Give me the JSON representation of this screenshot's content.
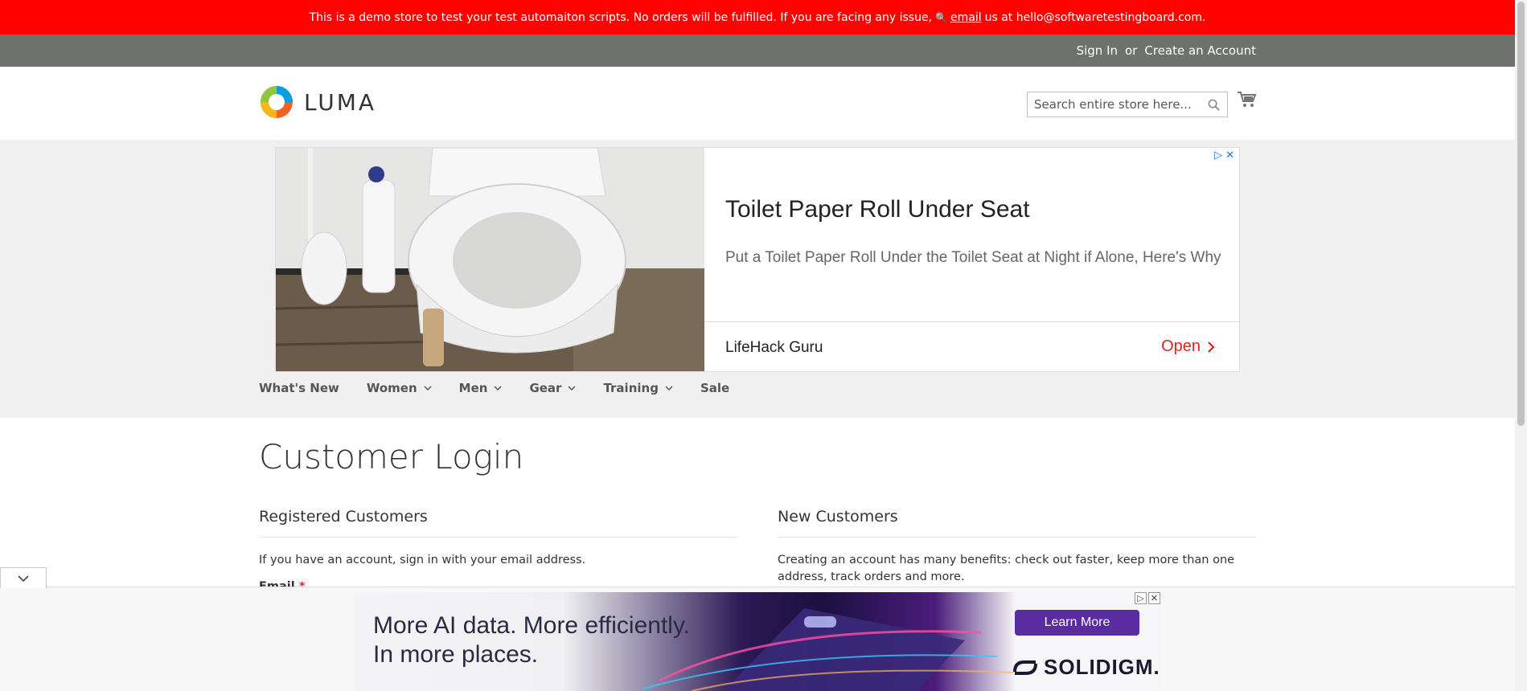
{
  "demo_notice": {
    "text_before": "This is a demo store to test your test automaiton scripts. No orders will be fulfilled. If you are facing any issue,",
    "link": "email",
    "text_after": "us at hello@softwaretestingboard.com."
  },
  "header_links": {
    "sign_in": "Sign In",
    "or": "or",
    "create_account": "Create an Account"
  },
  "logo": {
    "text": "LUMA"
  },
  "search": {
    "placeholder": "Search entire store here..."
  },
  "ad": {
    "title": "Toilet Paper Roll Under Seat",
    "description": "Put a Toilet Paper Roll Under the Toilet Seat at Night if Alone, Here's Why",
    "advertiser": "LifeHack Guru",
    "cta": "Open"
  },
  "nav": {
    "items": [
      {
        "label": "What's New"
      },
      {
        "label": "Women"
      },
      {
        "label": "Men"
      },
      {
        "label": "Gear"
      },
      {
        "label": "Training"
      },
      {
        "label": "Sale"
      }
    ]
  },
  "main": {
    "title": "Customer Login",
    "registered": {
      "heading": "Registered Customers",
      "text": "If you have an account, sign in with your email address.",
      "email_label": "Email",
      "required_mark": "*"
    },
    "new_customers": {
      "heading": "New Customers",
      "text": "Creating an account has many benefits: check out faster, keep more than one address, track orders and more."
    }
  },
  "bottom_ad": {
    "headline_line1": "More AI data. More efficiently.",
    "headline_line2": "In more places.",
    "cta": "Learn More",
    "brand": "SOLIDIGM."
  },
  "colors": {
    "demo_bar": "#ff0101",
    "panel": "#6e716e",
    "ad_cta": "#e0241b",
    "banner_cta": "#5b2ca0"
  }
}
